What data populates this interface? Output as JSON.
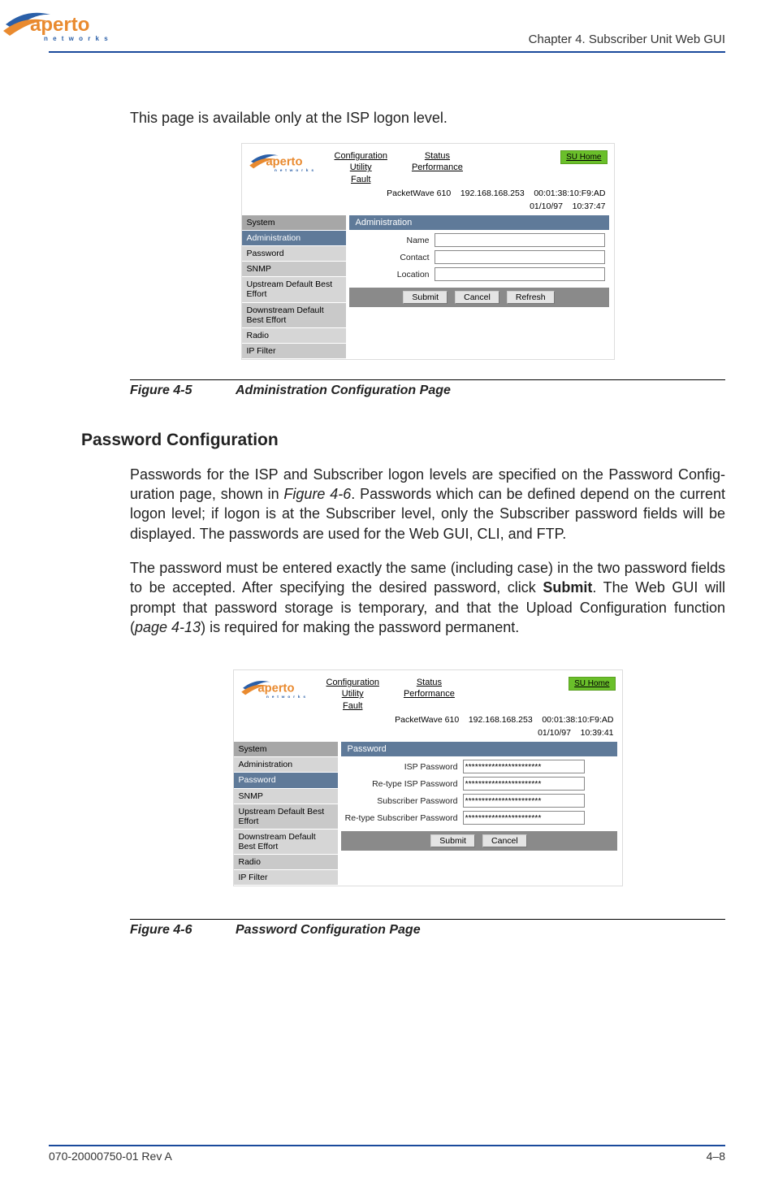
{
  "header": {
    "chapter": "Chapter 4.  Subscriber Unit Web GUI"
  },
  "intro": "This page is available only at the ISP logon level.",
  "figure1": {
    "num": "Figure 4-5",
    "title": "Administration Configuration Page"
  },
  "section2": {
    "heading": "Password Configuration",
    "para1_a": "Passwords for the ISP and Subscriber logon levels are specified on the Password Config­uration page, shown in ",
    "para1_ref": "Figure 4-6",
    "para1_b": ". Passwords which can be defined depend on the current logon level; if logon is at the Subscriber level, only the Subscriber password fields will be displayed. The passwords are used for the Web GUI, CLI, and FTP.",
    "para2_a": "The password must be entered exactly the same (including case) in the two password fields to be accepted. After specifying the desired password, click ",
    "para2_bold": "Submit",
    "para2_b": ". The Web GUI will prompt that password storage is temporary, and that the Upload Configuration func­tion (",
    "para2_ref": "page 4-13",
    "para2_c": ") is required for making the password permanent."
  },
  "figure2": {
    "num": "Figure 4-6",
    "title": "Password Configuration Page"
  },
  "footer": {
    "left": "070-20000750-01 Rev A",
    "right": "4–8"
  },
  "logo": {
    "brand": "aperto",
    "sub": "n e t w o r k s"
  },
  "shot_common": {
    "nav1": {
      "a": "Configuration",
      "b": "Utility",
      "c": "Fault"
    },
    "nav2": {
      "a": "Status",
      "b": "Performance"
    },
    "su_home": "SU Home",
    "device": "PacketWave 610",
    "ip": "192.168.168.253",
    "mac": "00:01:38:10:F9:AD",
    "date": "01/10/97",
    "menu": {
      "system": "System",
      "admin": "Administration",
      "password": "Password",
      "snmp": "SNMP",
      "upstream": "Upstream Default Best Effort",
      "downstream": "Downstream Default Best Effort",
      "radio": "Radio",
      "ipfilter": "IP Filter"
    },
    "btn": {
      "submit": "Submit",
      "cancel": "Cancel",
      "refresh": "Refresh"
    }
  },
  "shot1": {
    "time": "10:37:47",
    "panel_title": "Administration",
    "labels": {
      "name": "Name",
      "contact": "Contact",
      "location": "Location"
    }
  },
  "shot2": {
    "time": "10:39:41",
    "panel_title": "Password",
    "labels": {
      "isp": "ISP Password",
      "reisp": "Re-type ISP Password",
      "sub": "Subscriber Password",
      "resub": "Re-type Subscriber Password"
    },
    "mask": "***********************"
  }
}
